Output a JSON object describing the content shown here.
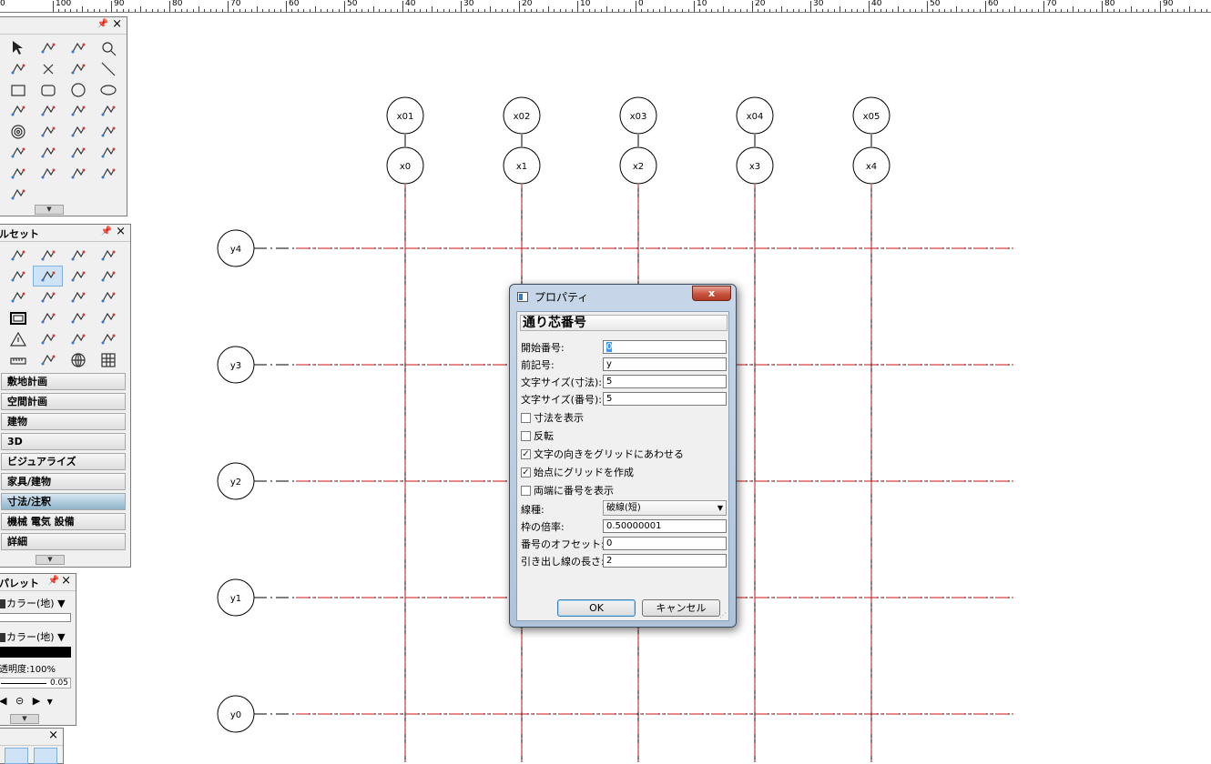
{
  "ruler": {
    "labels": [
      "100",
      "90",
      "80",
      "70",
      "60",
      "50",
      "40",
      "30",
      "20",
      "10",
      "0",
      "10",
      "20",
      "30",
      "40",
      "50",
      "60",
      "70",
      "80",
      "90"
    ],
    "edge_label": "0"
  },
  "grid": {
    "x_outer": [
      "x01",
      "x02",
      "x03",
      "x04",
      "x05"
    ],
    "x_inner": [
      "x0",
      "x1",
      "x2",
      "x3",
      "x4"
    ],
    "y": [
      "y4",
      "y3",
      "y2",
      "y1",
      "y0"
    ],
    "line_color": "#d01010"
  },
  "tool_palette": {
    "tools": [
      "select-arrow-icon",
      "pan-hand-icon",
      "rotate-view-icon",
      "zoom-icon",
      "text-icon",
      "delete-x-icon",
      "cut-icon",
      "line-icon",
      "rectangle-icon",
      "rounded-rectangle-icon",
      "circle-icon",
      "ellipse-icon",
      "freehand-icon",
      "polygon-icon",
      "curve-icon",
      "surface-icon",
      "spiral-icon",
      "eyedropper-icon",
      "magic-wand-icon",
      "reshape-icon",
      "attribute-brush-icon",
      "rotate-point-icon",
      "mirror-icon",
      "trim-knife-icon",
      "clip-hand-icon",
      "fillet-icon",
      "chamfer-icon",
      "offset-icon",
      "leader-icon"
    ]
  },
  "tool_set": {
    "title": "ルセット",
    "tools": [
      "dimension-icon",
      "angle-dim-icon",
      "arc-dim-icon",
      "radius-dim-icon",
      "elevation-icon",
      "grid-axis-icon",
      "break-line-icon",
      "datum-icon",
      "protractor-icon",
      "callout-icon",
      "red-pen-icon",
      "hatch-icon",
      "frame-icon",
      "target-icon",
      "section-marker-icon",
      "step-line-icon",
      "warning-icon",
      "north-arrow-icon",
      "id-tag-icon",
      "sheet-list-icon",
      "ruler-icon",
      "wave-line-icon",
      "globe-grid-icon",
      "table-grid-icon"
    ],
    "categories": [
      "敷地計画",
      "空間計画",
      "建物",
      "3D",
      "ビジュアライズ",
      "家具/建物",
      "寸法/注釈",
      "機械 電気 設備",
      "詳細"
    ],
    "active_category": "寸法/注釈"
  },
  "attr_palette": {
    "title": "パレット",
    "fill_label": "カラー(地)",
    "line_label": "カラー(地)",
    "line_weight": "0.05",
    "opacity": "透明度:100%"
  },
  "dialog": {
    "title": "プロパティ",
    "close": "x",
    "heading": "通り芯番号",
    "fields": {
      "start_label": "開始番号:",
      "start_value": "0",
      "prefix_label": "前記号:",
      "prefix_value": "y",
      "textsize_dim_label": "文字サイズ(寸法):",
      "textsize_dim_value": "5",
      "textsize_num_label": "文字サイズ(番号):",
      "textsize_num_value": "5",
      "linetype_label": "線種:",
      "linetype_value": "破線(短)",
      "frame_ratio_label": "枠の倍率:",
      "frame_ratio_value": "0.50000001",
      "num_offset_label": "番号のオフセット:",
      "num_offset_value": "0",
      "leader_len_label": "引き出し線の長さ:",
      "leader_len_value": "2"
    },
    "checkboxes": [
      {
        "label": "寸法を表示",
        "checked": false
      },
      {
        "label": "反転",
        "checked": false
      },
      {
        "label": "文字の向きをグリッドにあわせる",
        "checked": true
      },
      {
        "label": "始点にグリッドを作成",
        "checked": true
      },
      {
        "label": "両端に番号を表示",
        "checked": false
      }
    ],
    "ok": "OK",
    "cancel": "キャンセル"
  }
}
